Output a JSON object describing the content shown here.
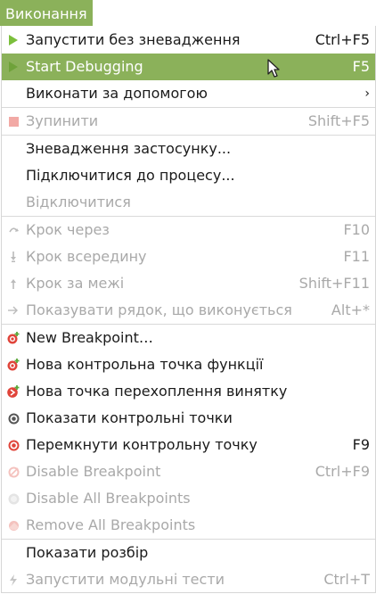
{
  "menubar": {
    "title": "Виконання"
  },
  "items": [
    {
      "label": "Запустити без зневадження",
      "shortcut": "Ctrl+F5",
      "icon": "play-icon",
      "disabled": false
    },
    {
      "label": "Start Debugging",
      "shortcut": "F5",
      "icon": "debug-play-icon",
      "disabled": false,
      "highlighted": true
    },
    {
      "label": "Виконати за допомогою",
      "submenu_arrow": "›",
      "disabled": false
    },
    {
      "label": "Зупинити",
      "shortcut": "Shift+F5",
      "icon": "stop-icon",
      "disabled": true
    },
    {
      "label": "Зневадження застосунку...",
      "disabled": false
    },
    {
      "label": "Підключитися до процесу...",
      "disabled": false
    },
    {
      "label": "Відключитися",
      "disabled": true
    },
    {
      "label": "Крок через",
      "shortcut": "F10",
      "icon": "step-over-icon",
      "disabled": true
    },
    {
      "label": "Крок всередину",
      "shortcut": "F11",
      "icon": "step-into-icon",
      "disabled": true
    },
    {
      "label": "Крок за межі",
      "shortcut": "Shift+F11",
      "icon": "step-out-icon",
      "disabled": true
    },
    {
      "label": "Показувати рядок, що виконується",
      "shortcut": "Alt+*",
      "icon": "show-next-statement-icon",
      "disabled": true
    },
    {
      "label": "New Breakpoint…",
      "icon": "new-breakpoint-icon",
      "disabled": false
    },
    {
      "label": "Нова контрольна точка функції",
      "icon": "new-function-breakpoint-icon",
      "disabled": false
    },
    {
      "label": "Нова точка перехоплення винятку",
      "icon": "new-exception-catchpoint-icon",
      "disabled": false
    },
    {
      "label": "Показати контрольні точки",
      "icon": "breakpoints-list-icon",
      "disabled": false
    },
    {
      "label": "Перемкнути контрольну точку",
      "shortcut": "F9",
      "icon": "toggle-breakpoint-icon",
      "disabled": false
    },
    {
      "label": "Disable Breakpoint",
      "shortcut": "Ctrl+F9",
      "icon": "disable-breakpoint-icon",
      "disabled": true
    },
    {
      "label": "Disable All Breakpoints",
      "icon": "disable-all-breakpoints-icon",
      "disabled": true
    },
    {
      "label": "Remove All Breakpoints",
      "icon": "remove-all-breakpoints-icon",
      "disabled": true
    },
    {
      "label": "Показати розбір",
      "disabled": false
    },
    {
      "label": "Запустити модульні тести",
      "shortcut": "Ctrl+T",
      "icon": "run-unit-tests-icon",
      "disabled": true
    }
  ],
  "colors": {
    "accent": "#8bb15a",
    "disabled_text": "#a9a9a9",
    "breakpoint_red": "#e0443a",
    "play_green": "#7bbf3c"
  }
}
